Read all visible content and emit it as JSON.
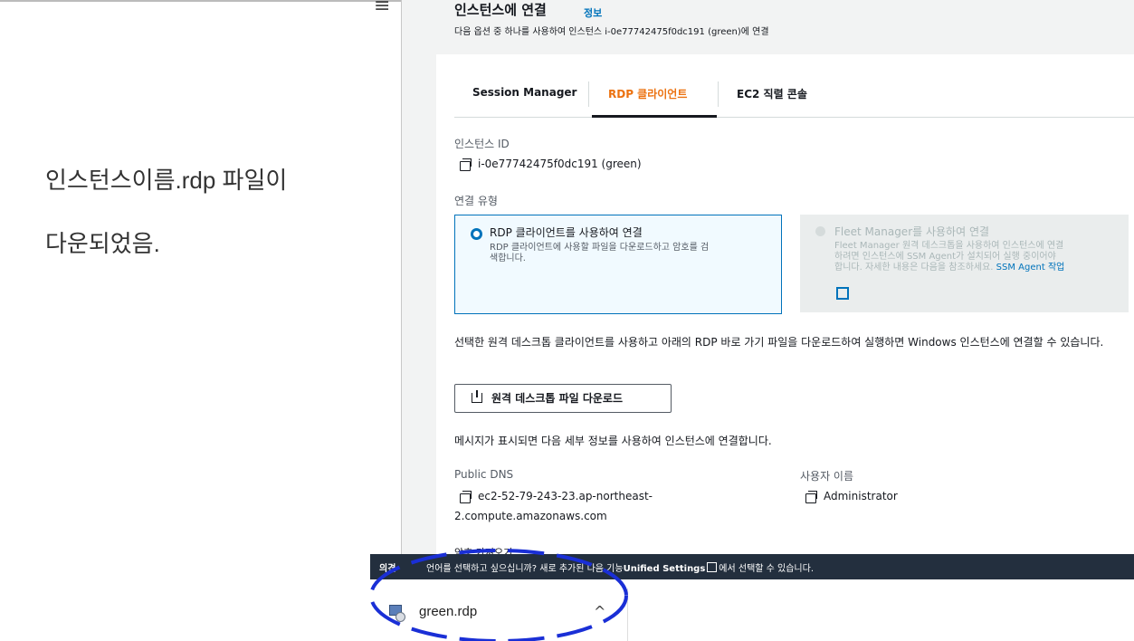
{
  "annotation": {
    "line1": "인스턴스이름.rdp 파일이",
    "line2": "다운되었음."
  },
  "header": {
    "menu_icon": "≡",
    "title": "인스턴스에 연결",
    "info": "정보",
    "subtitle": "다음 옵션 중 하나를 사용하여 인스턴스 i-0e77742475f0dc191 (green)에 연결"
  },
  "tabs": [
    {
      "label": "Session Manager"
    },
    {
      "label": "RDP 클라이언트"
    },
    {
      "label": "EC2 직렬 콘솔"
    }
  ],
  "instance": {
    "id_label": "인스턴스 ID",
    "id_value": "i-0e77742475f0dc191 (green)"
  },
  "connection": {
    "type_label": "연결 유형",
    "option1_title": "RDP 클라이언트를 사용하여 연결",
    "option1_desc_1": "RDP 클라이언트에 사용할 파일을 다운로드하고 암호를 검",
    "option1_desc_2": "색합니다.",
    "option2_title": "Fleet Manager를 사용하여 연결",
    "option2_desc_1": "Fleet Manager 원격 데스크톱을 사용하여 인스턴스에 연결",
    "option2_desc_2": "하려면 인스턴스에 SSM Agent가 설치되어 실행 중이어야",
    "option2_desc_3": "합니다. 자세한 내용은 다음을 참조하세요.",
    "option2_link": "SSM Agent 작업"
  },
  "description": "선택한 원격 데스크톱 클라이언트를 사용하고 아래의 RDP 바로 가기 파일을 다운로드하여 실행하면 Windows 인스턴스에 연결할 수 있습니다.",
  "download_button": "원격 데스크톱 파일 다운로드",
  "message": "메시지가 표시되면 다음 세부 정보를 사용하여 인스턴스에 연결합니다.",
  "details": {
    "dns_label": "Public DNS",
    "dns_value_1": "ec2-52-79-243-23.ap-northeast-",
    "dns_value_2": "2.compute.amazonaws.com",
    "user_label": "사용자 이름",
    "user_value": "Administrator"
  },
  "partial_text": "암호 가져오기",
  "footer": {
    "label": "의견",
    "text_before": "언어를 선택하고 싶으십니까? 새로 추가된 다음 기능",
    "text_bold": "Unified Settings",
    "text_after": "에서 선택할 수 있습니다."
  },
  "download_shelf": {
    "file_name": "green.rdp",
    "chevron": "^"
  },
  "colors": {
    "accent": "#0073bb",
    "tab_active": "#ec7211",
    "footer_bg": "#232f3e",
    "annotation_circle": "#1a2fd6"
  }
}
